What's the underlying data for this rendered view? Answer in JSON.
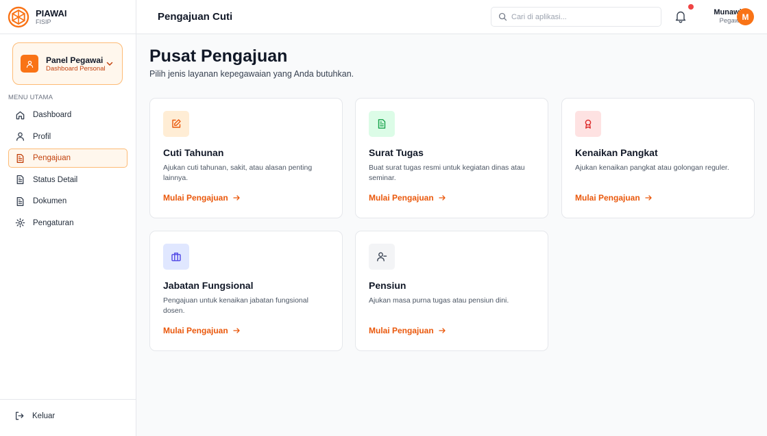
{
  "brand": {
    "name": "PIAWAI",
    "sub": "FISIP",
    "accent": "#f97316"
  },
  "panel": {
    "title": "Panel Pegawai",
    "subtitle": "Dashboard Personal"
  },
  "menu": {
    "heading": "MENU UTAMA",
    "items": [
      {
        "label": "Dashboard",
        "icon": "home-icon"
      },
      {
        "label": "Profil",
        "icon": "user-icon"
      },
      {
        "label": "Pengajuan",
        "icon": "file-icon",
        "active": true
      },
      {
        "label": "Status Detail",
        "icon": "file-icon"
      },
      {
        "label": "Dokumen",
        "icon": "file-icon"
      },
      {
        "label": "Pengaturan",
        "icon": "gear-icon"
      }
    ],
    "logout": "Keluar"
  },
  "header": {
    "title": "Pengajuan Cuti",
    "search_placeholder": "Cari di aplikasi...",
    "user_name": "Munawir",
    "user_role": "Pegawai",
    "avatar_initial": "M"
  },
  "main": {
    "title": "Pusat Pengajuan",
    "subtitle": "Pilih jenis layanan kepegawaian yang Anda butuhkan.",
    "cards": [
      {
        "title": "Cuti Tahunan",
        "desc": "Ajukan cuti tahunan, sakit, atau alasan penting lainnya.",
        "link": "Mulai Pengajuan",
        "icon": "edit-icon",
        "icon_bg": "#ffedd5",
        "icon_color": "#ea580c"
      },
      {
        "title": "Surat Tugas",
        "desc": "Buat surat tugas resmi untuk kegiatan dinas atau seminar.",
        "link": "Mulai Pengajuan",
        "icon": "document-icon",
        "icon_bg": "#dcfce7",
        "icon_color": "#16a34a"
      },
      {
        "title": "Kenaikan Pangkat",
        "desc": "Ajukan kenaikan pangkat atau golongan reguler.",
        "link": "Mulai Pengajuan",
        "icon": "award-icon",
        "icon_bg": "#fee2e2",
        "icon_color": "#dc2626"
      },
      {
        "title": "Jabatan Fungsional",
        "desc": "Pengajuan untuk kenaikan jabatan fungsional dosen.",
        "link": "Mulai Pengajuan",
        "icon": "briefcase-icon",
        "icon_bg": "#e0e7ff",
        "icon_color": "#4f46e5"
      },
      {
        "title": "Pensiun",
        "desc": "Ajukan masa purna tugas atau pensiun dini.",
        "link": "Mulai Pengajuan",
        "icon": "user-minus-icon",
        "icon_bg": "#f3f4f6",
        "icon_color": "#374151"
      }
    ]
  }
}
